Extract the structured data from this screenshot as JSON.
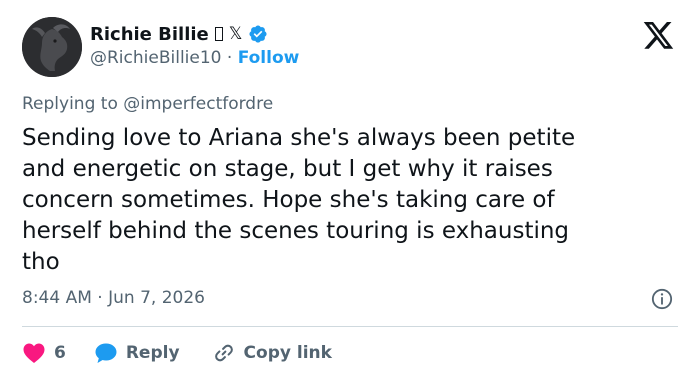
{
  "author": {
    "display_name": "Richie Billie",
    "emoji_placeholder": "▯",
    "x_mark": "𝕏",
    "handle": "@RichieBillie10",
    "separator": "·",
    "follow_label": "Follow",
    "verified_color": "#1d9bf0"
  },
  "reply_context": {
    "prefix": "Replying to",
    "mention": "@imperfectfordre"
  },
  "tweet": {
    "text": "Sending love to Ariana she's always been petite\nand energetic on stage, but I get why it raises\nconcern sometimes. Hope she's taking care of\nherself behind the scenes touring is exhausting\ntho",
    "time": "8:44 AM",
    "separator": "·",
    "date": "Jun 7, 2026"
  },
  "actions": {
    "like_count": "6",
    "reply_label": "Reply",
    "copy_link_label": "Copy link"
  },
  "colors": {
    "accent": "#1d9bf0",
    "like": "#f91880",
    "text": "#0f1419",
    "muted": "#536471"
  },
  "icons": {
    "brand": "x-logo-icon",
    "verified": "verified-badge-icon",
    "info": "info-icon",
    "like": "heart-icon",
    "reply": "speech-bubble-icon",
    "copy": "link-icon"
  }
}
